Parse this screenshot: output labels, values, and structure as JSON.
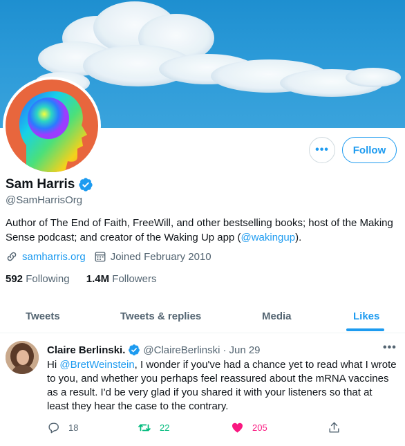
{
  "profile": {
    "name": "Sam Harris",
    "handle": "@SamHarrisOrg",
    "bio_prefix": "Author of The End of Faith, FreeWill, and other bestselling books; host of the Making Sense podcast; and creator of the Waking Up app (",
    "bio_mention": "@wakingup",
    "bio_suffix": ").",
    "website": "samharris.org",
    "joined": "Joined February 2010",
    "following_count": "592",
    "following_label": "Following",
    "followers_count": "1.4M",
    "followers_label": "Followers",
    "follow_label": "Follow",
    "more_label": "•••"
  },
  "tabs": [
    {
      "label": "Tweets"
    },
    {
      "label": "Tweets & replies"
    },
    {
      "label": "Media"
    },
    {
      "label": "Likes"
    }
  ],
  "tweet": {
    "author": "Claire Berlinski.",
    "handle": "@ClaireBerlinski",
    "separator": "·",
    "date": "Jun 29",
    "more_label": "•••",
    "text_prefix": "Hi ",
    "mention": "@BretWeinstein",
    "text_body": ", I wonder if you've had a chance yet to read what I wrote to you, and whether you perhaps feel  reassured about the mRNA vaccines as a result. I'd be very glad if you shared it with your listeners so that at least they hear the case to the contrary.",
    "replies": "18",
    "retweets": "22",
    "likes": "205"
  },
  "colors": {
    "accent": "#1d9bf0",
    "retweet": "#00ba7c",
    "like": "#f91880",
    "muted": "#536471"
  }
}
